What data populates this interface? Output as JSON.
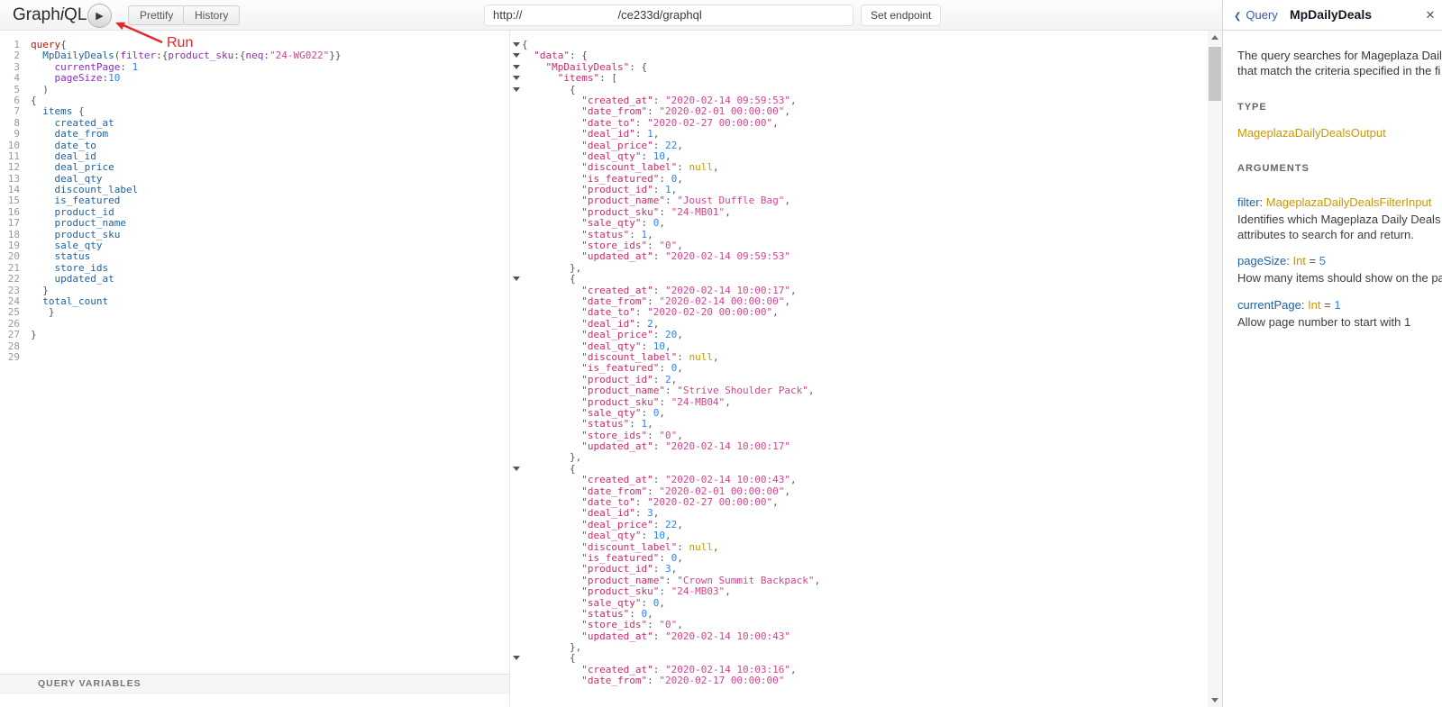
{
  "icons": {
    "play": "▶",
    "back": "❮",
    "close": "✕"
  },
  "toolbar": {
    "logo": {
      "graph": "Graph",
      "i": "i",
      "ql": "QL"
    },
    "prettify_label": "Prettify",
    "history_label": "History",
    "endpoint_url_prefix": "http://",
    "endpoint_url_suffix": "/ce233d/graphql",
    "set_endpoint_label": "Set endpoint",
    "run_annotation_label": "Run"
  },
  "query_editor": {
    "variables_title": "QUERY VARIABLES",
    "lines": [
      {
        "n": "1",
        "t": [
          [
            "kw",
            "query"
          ],
          [
            "p",
            "{"
          ]
        ]
      },
      {
        "n": "2",
        "t": [
          [
            "p",
            "  "
          ],
          [
            "field",
            "MpDailyDeals"
          ],
          [
            "p",
            "("
          ],
          [
            "attr",
            "filter"
          ],
          [
            "p",
            ":{"
          ],
          [
            "attr",
            "product_sku"
          ],
          [
            "p",
            ":{"
          ],
          [
            "attr",
            "neq"
          ],
          [
            "p",
            ":"
          ],
          [
            "str",
            "\"24-WG022\""
          ],
          [
            "p",
            "}}"
          ]
        ]
      },
      {
        "n": "3",
        "t": [
          [
            "p",
            "    "
          ],
          [
            "attr",
            "currentPage"
          ],
          [
            "p",
            ": "
          ],
          [
            "num",
            "1"
          ]
        ]
      },
      {
        "n": "4",
        "t": [
          [
            "p",
            "    "
          ],
          [
            "attr",
            "pageSize"
          ],
          [
            "p",
            ":"
          ],
          [
            "num",
            "10"
          ]
        ]
      },
      {
        "n": "5",
        "t": [
          [
            "p",
            "  )"
          ]
        ]
      },
      {
        "n": "6",
        "t": [
          [
            "p",
            "{"
          ]
        ]
      },
      {
        "n": "7",
        "t": [
          [
            "p",
            "  "
          ],
          [
            "field",
            "items"
          ],
          [
            "p",
            " {"
          ]
        ]
      },
      {
        "n": "8",
        "t": [
          [
            "p",
            "    "
          ],
          [
            "field",
            "created_at"
          ]
        ]
      },
      {
        "n": "9",
        "t": [
          [
            "p",
            "    "
          ],
          [
            "field",
            "date_from"
          ]
        ]
      },
      {
        "n": "10",
        "t": [
          [
            "p",
            "    "
          ],
          [
            "field",
            "date_to"
          ]
        ]
      },
      {
        "n": "11",
        "t": [
          [
            "p",
            "    "
          ],
          [
            "field",
            "deal_id"
          ]
        ]
      },
      {
        "n": "12",
        "t": [
          [
            "p",
            "    "
          ],
          [
            "field",
            "deal_price"
          ]
        ]
      },
      {
        "n": "13",
        "t": [
          [
            "p",
            "    "
          ],
          [
            "field",
            "deal_qty"
          ]
        ]
      },
      {
        "n": "14",
        "t": [
          [
            "p",
            "    "
          ],
          [
            "field",
            "discount_label"
          ]
        ]
      },
      {
        "n": "15",
        "t": [
          [
            "p",
            "    "
          ],
          [
            "field",
            "is_featured"
          ]
        ]
      },
      {
        "n": "16",
        "t": [
          [
            "p",
            "    "
          ],
          [
            "field",
            "product_id"
          ]
        ]
      },
      {
        "n": "17",
        "t": [
          [
            "p",
            "    "
          ],
          [
            "field",
            "product_name"
          ]
        ]
      },
      {
        "n": "18",
        "t": [
          [
            "p",
            "    "
          ],
          [
            "field",
            "product_sku"
          ]
        ]
      },
      {
        "n": "19",
        "t": [
          [
            "p",
            "    "
          ],
          [
            "field",
            "sale_qty"
          ]
        ]
      },
      {
        "n": "20",
        "t": [
          [
            "p",
            "    "
          ],
          [
            "field",
            "status"
          ]
        ]
      },
      {
        "n": "21",
        "t": [
          [
            "p",
            "    "
          ],
          [
            "field",
            "store_ids"
          ]
        ]
      },
      {
        "n": "22",
        "t": [
          [
            "p",
            "    "
          ],
          [
            "field",
            "updated_at"
          ]
        ]
      },
      {
        "n": "23",
        "t": [
          [
            "p",
            "  }"
          ]
        ]
      },
      {
        "n": "24",
        "t": [
          [
            "p",
            "  "
          ],
          [
            "field",
            "total_count"
          ]
        ]
      },
      {
        "n": "25",
        "t": [
          [
            "p",
            "   }"
          ]
        ]
      },
      {
        "n": "26",
        "t": []
      },
      {
        "n": "27",
        "t": [
          [
            "p",
            "}"
          ]
        ]
      },
      {
        "n": "28",
        "t": []
      },
      {
        "n": "29",
        "t": []
      }
    ]
  },
  "response": {
    "body": {
      "data": {
        "MpDailyDeals": {
          "items": [
            {
              "created_at": "2020-02-14 09:59:53",
              "date_from": "2020-02-01 00:00:00",
              "date_to": "2020-02-27 00:00:00",
              "deal_id": 1,
              "deal_price": 22,
              "deal_qty": 10,
              "discount_label": null,
              "is_featured": 0,
              "product_id": 1,
              "product_name": "Joust Duffle Bag",
              "product_sku": "24-MB01",
              "sale_qty": 0,
              "status": 1,
              "store_ids": "0",
              "updated_at": "2020-02-14 09:59:53"
            },
            {
              "created_at": "2020-02-14 10:00:17",
              "date_from": "2020-02-14 00:00:00",
              "date_to": "2020-02-20 00:00:00",
              "deal_id": 2,
              "deal_price": 20,
              "deal_qty": 10,
              "discount_label": null,
              "is_featured": 0,
              "product_id": 2,
              "product_name": "Strive Shoulder Pack",
              "product_sku": "24-MB04",
              "sale_qty": 0,
              "status": 1,
              "store_ids": "0",
              "updated_at": "2020-02-14 10:00:17"
            },
            {
              "created_at": "2020-02-14 10:00:43",
              "date_from": "2020-02-01 00:00:00",
              "date_to": "2020-02-27 00:00:00",
              "deal_id": 3,
              "deal_price": 22,
              "deal_qty": 10,
              "discount_label": null,
              "is_featured": 0,
              "product_id": 3,
              "product_name": "Crown Summit Backpack",
              "product_sku": "24-MB03",
              "sale_qty": 0,
              "status": 0,
              "store_ids": "0",
              "updated_at": "2020-02-14 10:00:43"
            },
            {
              "created_at": "2020-02-14 10:03:16",
              "date_from": "2020-02-17 00:00:00"
            }
          ]
        }
      }
    }
  },
  "docs": {
    "back_label": "Query",
    "title": "MpDailyDeals",
    "description_lines": [
      "The query searches for Mageplaza Daily ",
      "that match the criteria specified in the fi"
    ],
    "type_section_label": "TYPE",
    "type_name": "MageplazaDailyDealsOutput",
    "arguments_section_label": "ARGUMENTS",
    "arguments": [
      {
        "name": "filter",
        "type": "MageplazaDailyDealsFilterInput",
        "default": null,
        "description_lines": [
          "Identifies which Mageplaza Daily Deals",
          "attributes to search for and return."
        ]
      },
      {
        "name": "pageSize",
        "type": "Int",
        "default": "5",
        "description_lines": [
          "How many items should show on the pa"
        ]
      },
      {
        "name": "currentPage",
        "type": "Int",
        "default": "1",
        "description_lines": [
          "Allow page number to start with 1"
        ]
      }
    ]
  }
}
